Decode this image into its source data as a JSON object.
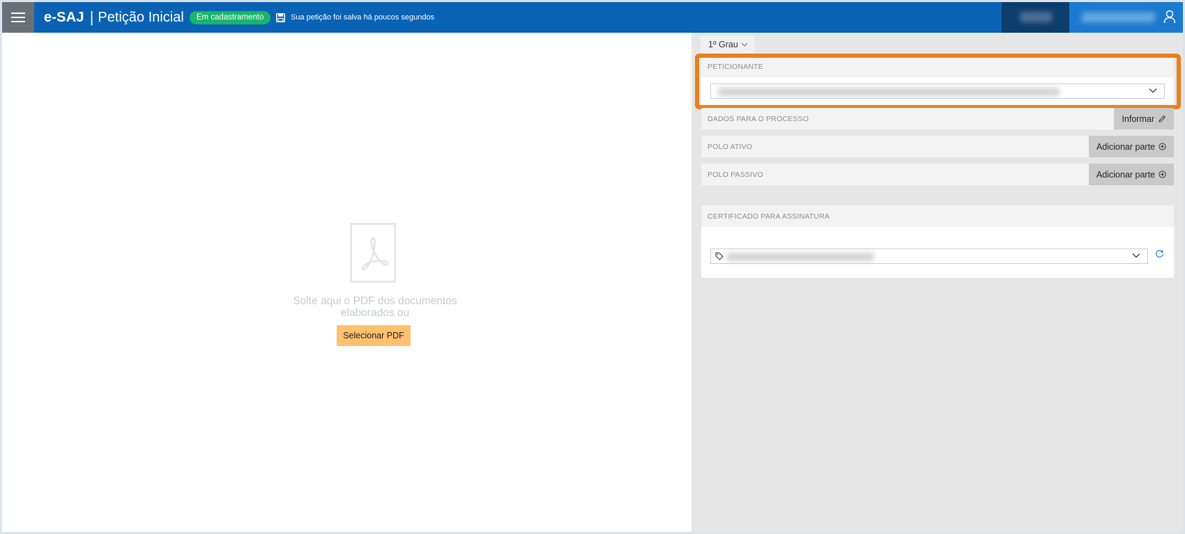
{
  "header": {
    "logo": "e-SAJ",
    "separator": "|",
    "title": "Petição Inicial",
    "status_badge": "Em cadastramento",
    "saved_message": "Sua petição foi salva há poucos segundos",
    "menu_icon": "hamburger-menu-icon",
    "save_icon": "floppy-disk-icon",
    "user_icon": "user-icon",
    "colors": {
      "bar": "#0a62b4",
      "badge": "#1bb56a"
    }
  },
  "upload": {
    "drop_text": "Solte aqui o PDF dos documentos elaborados ou",
    "select_button": "Selecionar PDF",
    "pdf_icon": "pdf-file-icon",
    "button_color": "#ffc06f"
  },
  "side": {
    "instance_selector": "1º Grau",
    "peticionante": {
      "label": "PETICIONANTE",
      "highlight_color": "#e8801d"
    },
    "dados_processo": {
      "label": "DADOS PARA O PROCESSO",
      "button": "Informar",
      "icon": "pencil-icon"
    },
    "polo_ativo": {
      "label": "POLO ATIVO",
      "button": "Adicionar parte",
      "icon": "plus-circle-icon"
    },
    "polo_passivo": {
      "label": "POLO PASSIVO",
      "button": "Adicionar parte",
      "icon": "plus-circle-icon"
    },
    "certificado": {
      "label": "CERTIFICADO PARA ASSINATURA",
      "tag_icon": "tag-icon",
      "refresh_icon": "refresh-icon"
    }
  }
}
